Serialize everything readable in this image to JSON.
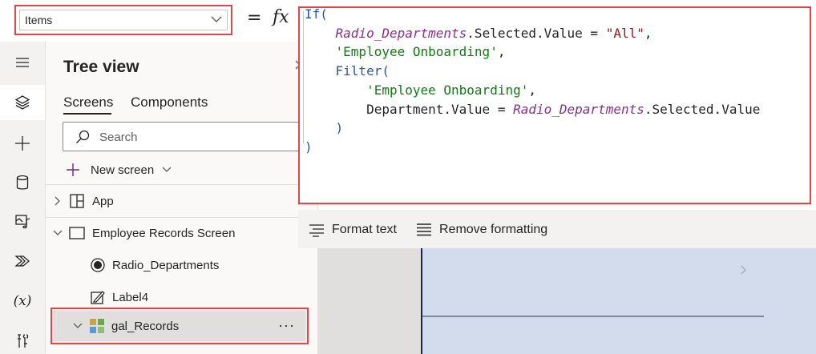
{
  "formula_bar": {
    "property": "Items",
    "equals": "=",
    "fx": "fx",
    "code": {
      "line1_kw": "If(",
      "line2_var": "Radio_Departments",
      "line2_rest": ".Selected.Value = ",
      "line2_str": "\"All\"",
      "line2_comma": ",",
      "line3_tbl": "'Employee Onboarding'",
      "line3_comma": ",",
      "line4_kw": "Filter(",
      "line5_tbl": "'Employee Onboarding'",
      "line5_comma": ",",
      "line6_plain": "Department.Value = ",
      "line6_var": "Radio_Departments",
      "line6_rest": ".Selected.Value",
      "line7_close": ")",
      "line8_close": ")"
    },
    "format_text": "Format text",
    "remove_formatting": "Remove formatting"
  },
  "rail": {
    "icons": [
      "hamburger-icon",
      "layers-icon",
      "plus-icon",
      "database-icon",
      "media-icon",
      "power-automate-icon",
      "variables-icon",
      "tools-icon"
    ],
    "variables_label": "(x)"
  },
  "tree_view": {
    "title": "Tree view",
    "tabs": [
      "Screens",
      "Components"
    ],
    "active_tab": "Screens",
    "search_placeholder": "Search",
    "new_screen": "New screen",
    "nodes": {
      "app": "App",
      "screen": "Employee Records Screen",
      "radio": "Radio_Departments",
      "label": "Label4",
      "gallery": "gal_Records"
    },
    "more": "···"
  },
  "colors": {
    "highlight_border": "#e0464a",
    "keyword": "#2b579a",
    "variable": "#8a2e8a",
    "string": "#a31515",
    "table": "#107c10"
  }
}
